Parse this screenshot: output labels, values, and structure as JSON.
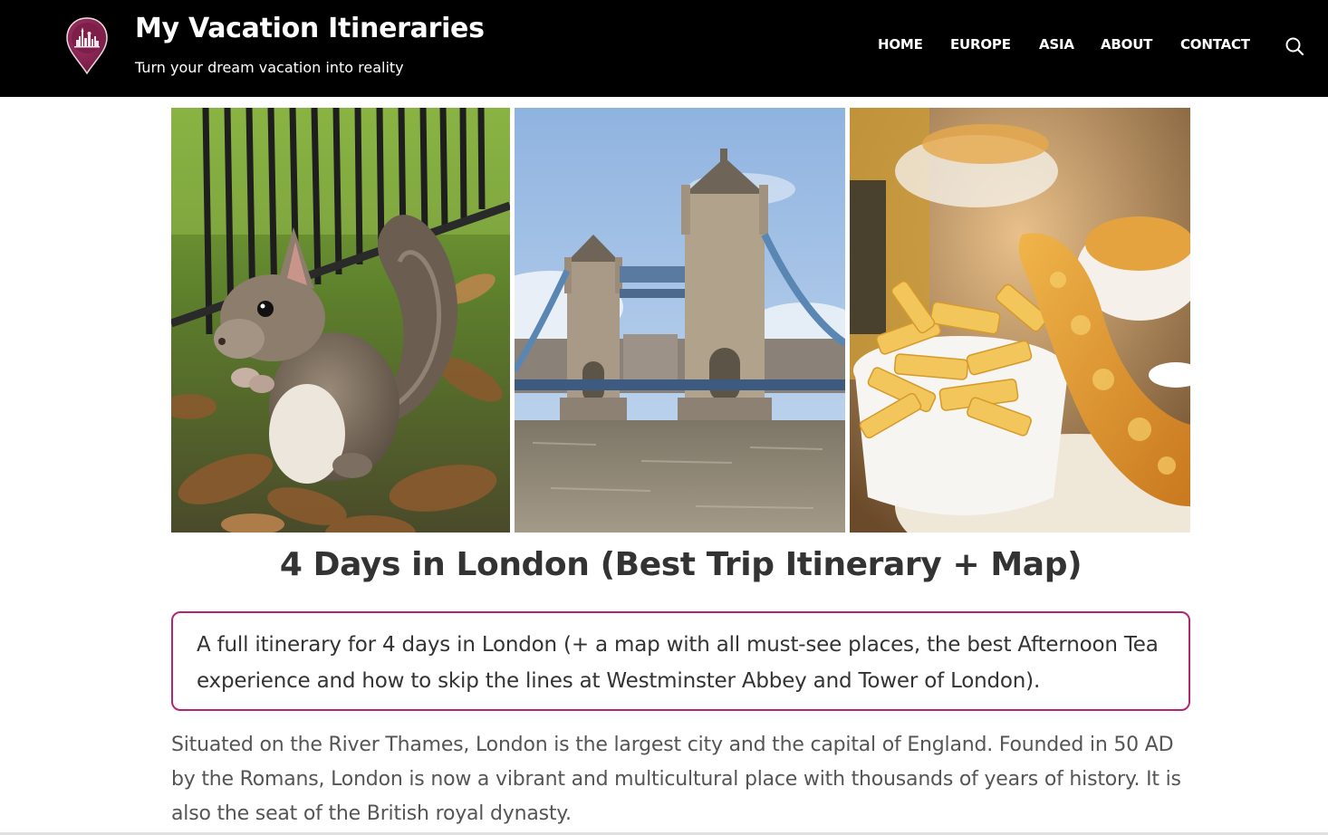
{
  "header": {
    "site_title": "My Vacation Itineraries",
    "tagline": "Turn your dream vacation into reality",
    "brand_color": "#8b2352",
    "logo_icon": "map-pin-city-icon",
    "search_icon": "search-icon"
  },
  "nav": {
    "items": [
      {
        "label": "HOME"
      },
      {
        "label": "EUROPE"
      },
      {
        "label": "ASIA"
      },
      {
        "label": "ABOUT"
      },
      {
        "label": "CONTACT"
      }
    ]
  },
  "hero": {
    "photos": [
      {
        "subject": "squirrel"
      },
      {
        "subject": "tower-bridge"
      },
      {
        "subject": "fish-and-chips"
      }
    ]
  },
  "article": {
    "title": "4 Days in London (Best Trip Itinerary + Map)",
    "summary": "A full itinerary for 4 days in London (+ a map with all must-see places, the best Afternoon Tea experience and how to skip the lines at Westminster Abbey and Tower of London).",
    "intro": "Situated on the River Thames, London is the largest city and the capital of England. Founded in 50 AD by the Romans, London is now a vibrant and multicultural place with thousands of years of history. It is also the seat of the British royal dynasty.",
    "accent_color": "#b3266f"
  }
}
